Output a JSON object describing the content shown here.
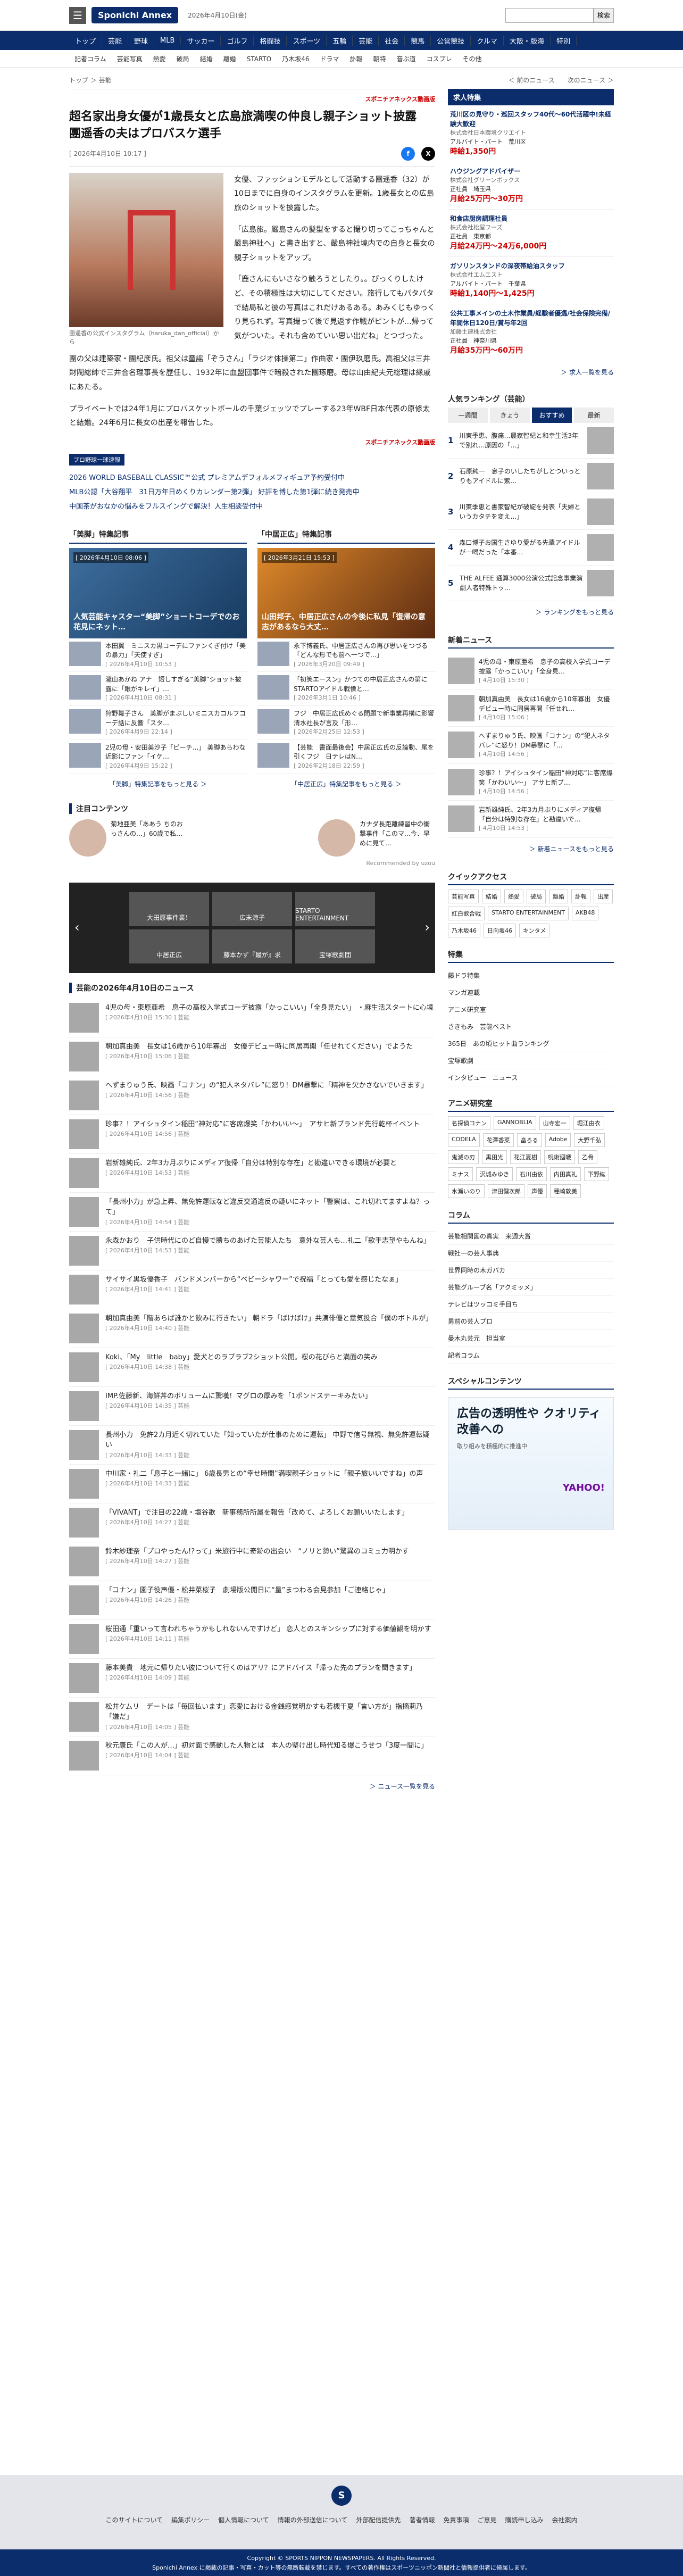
{
  "header": {
    "logo": "Sponichi Annex",
    "date": "2026年4月10日(金)",
    "search_button": "検索",
    "search_placeholder": ""
  },
  "gnav": [
    "トップ",
    "芸能",
    "野球",
    "MLB",
    "サッカー",
    "ゴルフ",
    "格闘技",
    "スポーツ",
    "五輪",
    "芸能",
    "社会",
    "競馬",
    "公営競技",
    "クルマ",
    "大阪・版海",
    "特別"
  ],
  "subnav": [
    "記者コラム",
    "芸能写真",
    "熱愛",
    "破局",
    "結婚",
    "離婚",
    "STARTO",
    "乃木坂46",
    "ドラマ",
    "訃報",
    "朝特",
    "音ぶ道",
    "コスプレ",
    "その他"
  ],
  "breadcrumb": "トップ ＞ 芸能",
  "prev_next": "＜ 前のニュース　　次のニュース ＞",
  "article": {
    "source": "スポニチアネックス動画版",
    "title": "超名家出身女優が1歳長女と広島旅満喫の仲良し親子ショット披露　團遥香の夫はプロバスケ選手",
    "date": "[ 2026年4月10日 10:17 ]",
    "caption": "團遥香の公式インスタグラム（haruka_dan_official）から",
    "p1": "女優、ファッションモデルとして活動する團遥香（32）が10日までに自身のインスタグラムを更新。1歳長女との広島旅のショットを披露した。",
    "p2": "「広島旅。嚴島さんの髪型をすると撮り切ってこっちゃんと嚴島神社へ」と書き出すと、嚴島神社境内での自身と長女の親子ショットをアップ。",
    "p3": "「鹿さんにもいさなり触ろうとしたり。。びっくりしたけど、その積極性は大切にしてください。旅行してもパタパタで結局私と彼の写真はこれだけあるある。あみくじもゆっくり見られず。写真撮って後で見返す作戦がピントが…帰って気がついた。それも含めていい思い出だね」とつづった。",
    "p4": "團の父は建築家・團紀彦氏。祖父は童謡「ぞうさん」「ラジオ体操第二」作曲家・團伊玖磨氏。高祖父は三井財閥総帥で三井合名理事長を歴任し、1932年に血盟団事件で暗殺された團琢磨。母は山由紀夫元総理は縁戚にあたる。",
    "p5": "プライベートでは24年1月にプロバスケットボールの千葉ジェッツでプレーする23年WBF日本代表の原修太と結婚。24年6月に長女の出産を報告した。",
    "source_bottom": "スポニチアネックス動画版"
  },
  "pr": {
    "label": "プロ野球一球速報",
    "items": [
      "2026 WORLD BASEBALL CLASSIC™公式 プレミアムデフォルメフィギュア予約受付中",
      "MLB公認「大谷翔平　31日万年日めくりカレンダー第2弾」 好評を博した第1弾に続き発売中",
      "中国茶がおなかの悩みをフルスイングで解決！人生相談受付中"
    ]
  },
  "features": [
    {
      "head": "「美脚」特集記事",
      "top_title": "人気芸能キャスター“美脚”ショートコーデでのお花見にネット…",
      "top_date": "[ 2026年4月10日 08:06 ]",
      "items": [
        {
          "t": "本田翼　ミニスカ黒コーデにファンくぎ付け「美の暴力」「天使すぎ」",
          "d": "[ 2026年4月10日 10:53 ]"
        },
        {
          "t": "瀧山あかね アナ　短しすぎる“美脚”ショット披露に「眼がキレイ」…",
          "d": "[ 2026年4月10日 08:31 ]"
        },
        {
          "t": "狩野舞子さん　美脚がまぶしいミニスカコルフコーデ話に反響「スタ…",
          "d": "[ 2026年4月9日 22:14 ]"
        },
        {
          "t": "2児の母・安田美沙子「ピーチ…」 美脚あらわな近影にファン「イケ…",
          "d": "[ 2026年4月9日 15:22 ]"
        }
      ],
      "more": "「美脚」特集記事をもっと見る ＞"
    },
    {
      "head": "「中居正広」特集記事",
      "top_title": "山田邦子、中居正広さんの今後に私見「復帰の意志があるなら大丈…",
      "top_date": "[ 2026年3月21日 15:53 ]",
      "items": [
        {
          "t": "永下博義氏、中居正広さんの再び思いをつづる「どんな形でも前へ一つで…」",
          "d": "[ 2026年3月20日 09:49 ]"
        },
        {
          "t": "「初笑エースン」かつての中居正広さんの第にSTARTOアイドル戦慄と…",
          "d": "[ 2026年3月1日 10:46 ]"
        },
        {
          "t": "フジ　中居正広氏めぐる問題で新事業再構に影響　清水社長が言及「形…",
          "d": "[ 2026年2月25日 12:53 ]"
        },
        {
          "t": "【芸能　書面最後会】中居正広氏の反論動、尾を引くフジ　日テレはN…",
          "d": "[ 2026年2月18日 22:59 ]"
        }
      ],
      "more": "「中居正広」特集記事をもっと見る ＞"
    }
  ],
  "attention": {
    "head": "注目コンテンツ",
    "items": [
      {
        "t": "菊地亜美「ああう ちのおっさんの…」60歳で私…"
      },
      {
        "t": "カナダ長距離練習中の衝撃事件「このマ…今、早めに見て…"
      }
    ],
    "powered": "Recommended by uzou"
  },
  "banner_cards": [
    "大田原事件業！",
    "広末涼子",
    "STARTO ENTERTAINMENT",
    "中居正広",
    "藤本かず『最が』求",
    "宝塚歌劇団"
  ],
  "daily_news": {
    "head": "芸能の2026年4月10日のニュース",
    "items": [
      {
        "t": "4児の母・東原亜希　息子の高校入学式コーデ披露「かっこいい」「全身見たい」 ・麻生活スタートに心境",
        "d": "[ 2026年4月10日 15:30 ] 芸能"
      },
      {
        "t": "朝加真由美　長女は16歳から10年寡出　女優デビュー時に同居再開「任せれてください」でようた",
        "d": "[ 2026年4月10日 15:06 ] 芸能"
      },
      {
        "t": "へずまりゅう氏、映画「コナン」の“犯人ネタバレ”に怒り！DM暴撃に「精神を欠かさないでいきます」",
        "d": "[ 2026年4月10日 14:56 ] 芸能"
      },
      {
        "t": "珍事？！アイシュタイン稲田“神対応”に客席爆笑「かわいい〜」　アサヒ新ブランド先行乾杯イベント",
        "d": "[ 2026年4月10日 14:56 ] 芸能"
      },
      {
        "t": "岩新雄純氏、2年3カ月ぶりにメディア復帰「自分は特別な存在」と勘違いできる環境が必要と",
        "d": "[ 2026年4月10日 14:53 ] 芸能"
      },
      {
        "t": "「長州小力」が急上昇、無免許運転など違反交通違反の疑いにネット「警察は、これ切れてますよね？って」",
        "d": "[ 2026年4月10日 14:54 ] 芸能"
      },
      {
        "t": "永森かおり　子供時代にのど自慢で勝ちのあげた芸能人たち　意外な芸人も…礼二「歌手志望やもんね」",
        "d": "[ 2026年4月10日 14:53 ] 芸能"
      },
      {
        "t": "サイサイ黒坂優香子　バンドメンバーから“ベビーシャワー”で祝福「とっても愛を感じたなぁ」",
        "d": "[ 2026年4月10日 14:41 ] 芸能"
      },
      {
        "t": "朝加真由美「階あらば誰かと飲みに行きたい」 朝ドラ「ばけばけ」共演俳優と意気投合「僕のボトルが」",
        "d": "[ 2026年4月10日 14:40 ] 芸能"
      },
      {
        "t": "Koki、「My　little　baby」愛犬とのラブラブ2ショット公開。桜の花びらと満面の笑み",
        "d": "[ 2026年4月10日 14:38 ] 芸能"
      },
      {
        "t": "IMP.佐藤新、海鮮丼のボリュームに驚嘆！マグロの厚みを「1ポンドステーキみたい」",
        "d": "[ 2026年4月10日 14:35 ] 芸能"
      },
      {
        "t": "長州小力　免許2カ月近く切れていた「知っていたが仕事のために運転」 中野で信号無視、無免許運転疑い",
        "d": "[ 2026年4月10日 14:33 ] 芸能"
      },
      {
        "t": "中川家・礼二「息子と一緒に」 6歳長男との“幸せ時間”満喫親子ショットに「親子旅いいですね」の声",
        "d": "[ 2026年4月10日 14:33 ] 芸能"
      },
      {
        "t": "「VIVANT」で注目の22歳・塩谷歌　新事務所所属を報告「改めて、よろしくお願いいたします」",
        "d": "[ 2026年4月10日 14:27 ] 芸能"
      },
      {
        "t": "鈴木紗理奈「プロやったん!?って」米旅行中に奇跡の出会い　“ノリと勢い”驚異のコミュ力明かす",
        "d": "[ 2026年4月10日 14:27 ] 芸能"
      },
      {
        "t": "「コナン」園子役声優・松井菜桜子　劇場版公開日に“量”まつわる会見参加「ご連絡じゃ」",
        "d": "[ 2026年4月10日 14:26 ] 芸能"
      },
      {
        "t": "桜田通「重いって言われちゃうかもしれないんですけど」 恋人とのスキンシップに対する価値観を明かす",
        "d": "[ 2026年4月10日 14:11 ] 芸能"
      },
      {
        "t": "藤本美貴　地元に帰りたい彼について行くのはアリ？にアドバイス「帰った先のプランを聞きます」",
        "d": "[ 2026年4月10日 14:09 ] 芸能"
      },
      {
        "t": "松井ケムリ　デートは「毎回払います」恋愛における金銭感覚明かすも若槻千夏「言い方が」指摘莉乃「嫌だ」",
        "d": "[ 2026年4月10日 14:05 ] 芸能"
      },
      {
        "t": "秋元康氏「この人が…」初対面で感動した人物とは　本人の堅け出し時代知る爆こうせつ「3度一間に」",
        "d": "[ 2026年4月10日 14:04 ] 芸能"
      }
    ],
    "more": "＞ ニュース一覧を見る"
  },
  "side": {
    "jobs_head": "求人特集",
    "jobs": [
      {
        "t": "荒川区の見守り・巡回スタッフ40代〜60代活躍中!未経験大歓迎",
        "c": "株式会社日本環境クリエイト",
        "tag": "アルバイト・パート　荒川区",
        "pay": "時給1,350円"
      },
      {
        "t": "ハウジングアドバイザー",
        "c": "株式会社グリーンボックス",
        "tag": "正社員　埼玉県",
        "pay": "月給25万円〜30万円"
      },
      {
        "t": "和食店厨房調理社員",
        "c": "株式会社松屋フーズ",
        "tag": "正社員　東京都",
        "pay": "月給24万円〜24万6,000円"
      },
      {
        "t": "ガソリンスタンドの深夜帯給油スタッフ",
        "c": "株式会社エムエスト",
        "tag": "アルバイト・パート　千葉県",
        "pay": "時給1,140円〜1,425円"
      },
      {
        "t": "公共工事メインの土木作業員/経験者優遇/社会保険完備/年間休日120日/賞与年2回",
        "c": "加藤土建株式会社",
        "tag": "正社員　神奈川県",
        "pay": "月給35万円〜60万円"
      }
    ],
    "jobs_more": "＞ 求人一覧を見る",
    "ranking_head": "人気ランキング（芸能）",
    "ranking_tabs": [
      "一週間",
      "きょう",
      "おすすめ",
      "最新"
    ],
    "ranking": [
      {
        "t": "川東季恵、腹痛…農家智紀と和幸生活3年で別れ…原因の「…」"
      },
      {
        "t": "石原純一　息子のいしたちがしとついっとりもアイドルに紫…"
      },
      {
        "t": "川東季恵と書家智紀が破綻を発表「夫婦というカタチを変え…」"
      },
      {
        "t": "森口博子お国生さゆり愛がる先輩アイドルが一喝だった「本番…"
      },
      {
        "t": "THE ALFEE 通算3000公演公式記念事業演劇人者特殊トッ…"
      }
    ],
    "ranking_more": "＞ ランキングをもっと見る",
    "new_head": "新着ニュース",
    "new": [
      {
        "t": "4児の母・東原亜希　息子の高校入学式コーデ披露「かっこいい」「全身見…",
        "d": "[ 4月10日 15:30 ]"
      },
      {
        "t": "朝加真由美　長女は16歳から10年寡出　女優デビュー時に同居再開「任せれ…",
        "d": "[ 4月10日 15:06 ]"
      },
      {
        "t": "へずまりゅう氏、映画「コナン」の“犯人ネタバレ”に怒り！DM暴撃に「…",
        "d": "[ 4月10日 14:56 ]"
      },
      {
        "t": "珍事？！アイシュタイン稲田“神対応”に客席爆笑「かわいい〜」 アサヒ新ブ…",
        "d": "[ 4月10日 14:56 ]"
      },
      {
        "t": "岩新雄純氏、2年3カ月ぶりにメディア復帰「自分は特別な存在」と勘違いで…",
        "d": "[ 4月10日 14:53 ]"
      }
    ],
    "new_more": "＞ 新着ニュースをもっと見る",
    "quick_head": "クイックアクセス",
    "quick": [
      "芸能写真",
      "結婚",
      "熱愛",
      "破局",
      "離婚",
      "訃報",
      "出産",
      "紅白歌合戦",
      "STARTO ENTERTAINMENT",
      "AKB48",
      "乃木坂46",
      "日向坂46",
      "キンタメ"
    ],
    "special_head": "特集",
    "special": [
      "藤ドラ特集",
      "マンガ連載",
      "アニメ研究室",
      "さきもみ　芸能ベスト",
      "365日　あの頃ヒット曲ランキング",
      "宝塚歌劇",
      "インタビュー　ニュース"
    ],
    "anime_head": "アニメ研究室",
    "anime": [
      "名探偵コナン",
      "GANNOBLIA",
      "山寺宏一",
      "堀江由衣",
      "CODELA",
      "花澤香菜",
      "畠ろる",
      "Adobe",
      "大野千弘",
      "鬼滅の刃",
      "黒田光",
      "花江夏樹",
      "呪術廻戦",
      "乙骨",
      "ミナス",
      "沢城みゆき",
      "石川由依",
      "内田真礼",
      "下野紘",
      "水瀬いのり",
      "津田健次郎",
      "声優",
      "種崎敦美"
    ],
    "column_head": "コラム",
    "columns": [
      "芸能相関図の真実　来週大賞",
      "戦社一の芸人事典",
      "世界同時の木ガバカ",
      "芸能グルーブ名「アクミッメ」",
      "テレビはツッコミ手目ち",
      "男前の芸人プロ",
      "曼木丸芸元　担当室",
      "記者コラム"
    ],
    "special2_head": "スペシャルコンテンツ",
    "ad": {
      "t": "広告の透明性や クオリティ改善への",
      "s": "取り組みを積極的に推進中",
      "brand": "YAHOO!"
    }
  },
  "footer": {
    "logo": "S",
    "links": [
      "このサイトについて",
      "編集ポリシー",
      "個人情報について",
      "情報の外部送信について",
      "外部配信提供先",
      "著者情報",
      "免責事項",
      "ご意見",
      "購読申し込み",
      "会社案内"
    ],
    "copyright": "Copyright © SPORTS NIPPON NEWSPAPERS. All Rights Reserved.",
    "notice": "Sponichi Annex に掲載の記事・写真・カット等の無断転載を禁じます。すべての著作権はスポーツニッポン新聞社と情報提供者に帰属します。"
  }
}
